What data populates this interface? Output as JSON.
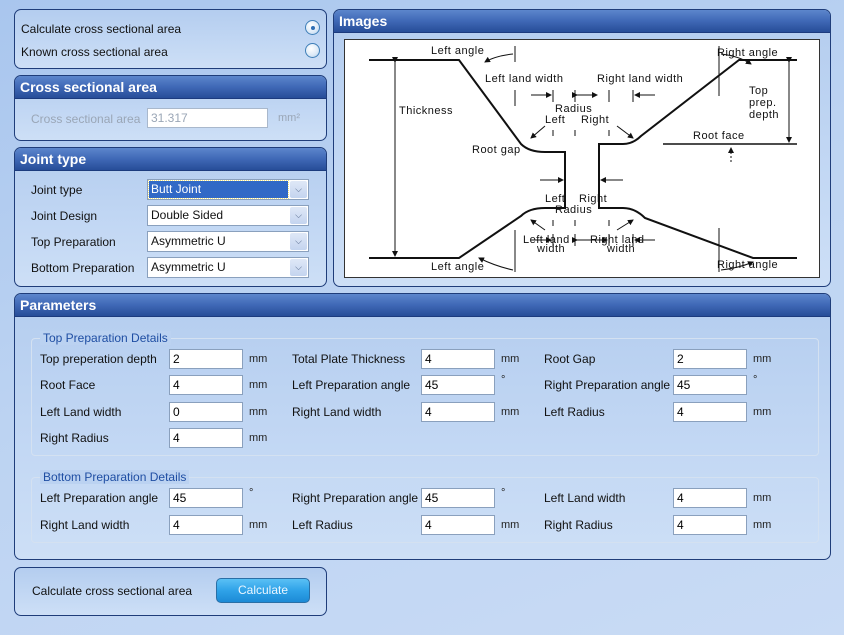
{
  "mode": {
    "options": [
      {
        "label": "Calculate cross sectional area",
        "selected": true
      },
      {
        "label": "Known cross sectional area",
        "selected": false
      }
    ]
  },
  "cross_section": {
    "title": "Cross sectional area",
    "field_label": "Cross sectional area",
    "value": "31.317",
    "unit": "mm²"
  },
  "joint_type": {
    "title": "Joint type",
    "fields": [
      {
        "label": "Joint type",
        "value": "Butt Joint"
      },
      {
        "label": "Joint Design",
        "value": "Double Sided"
      },
      {
        "label": "Top Preparation",
        "value": "Asymmetric U"
      },
      {
        "label": "Bottom Preparation",
        "value": "Asymmetric U"
      }
    ],
    "dropdown_icon": "chevron-down-icon"
  },
  "images": {
    "title": "Images",
    "diagram_labels": {
      "left_angle_top": "Left angle",
      "right_angle_top": "Right angle",
      "left_land_width_top": "Left land width",
      "right_land_width_top": "Right land width",
      "thickness": "Thickness",
      "radius_top": "Radius",
      "left_top": "Left",
      "right_top": "Right",
      "top_prep_1": "Top",
      "top_prep_2": "prep.",
      "top_prep_3": "depth",
      "root_face": "Root face",
      "root_gap": "Root gap",
      "left_bottom": "Left",
      "right_bottom": "Right",
      "radius_bottom": "Radius",
      "left_land_bottom_1": "Left land",
      "left_land_bottom_2": "width",
      "right_land_bottom_1": "Right land",
      "right_land_bottom_2": "width",
      "left_angle_bottom": "Left angle",
      "right_angle_bottom": "Right angle"
    }
  },
  "parameters": {
    "title": "Parameters",
    "top": {
      "title": "Top Preparation Details",
      "fields": [
        {
          "label": "Top preperation depth",
          "value": "2",
          "unit": "mm"
        },
        {
          "label": "Total Plate Thickness",
          "value": "4",
          "unit": "mm"
        },
        {
          "label": "Root Gap",
          "value": "2",
          "unit": "mm"
        },
        {
          "label": "Root Face",
          "value": "4",
          "unit": "mm"
        },
        {
          "label": "Left Preparation angle",
          "value": "45",
          "unit": "°"
        },
        {
          "label": "Right Preparation angle",
          "value": "45",
          "unit": "°"
        },
        {
          "label": "Left Land width",
          "value": "0",
          "unit": "mm"
        },
        {
          "label": "Right Land width",
          "value": "4",
          "unit": "mm"
        },
        {
          "label": "Left Radius",
          "value": "4",
          "unit": "mm"
        },
        {
          "label": "Right Radius",
          "value": "4",
          "unit": "mm"
        }
      ]
    },
    "bottom": {
      "title": "Bottom Preparation Details",
      "fields": [
        {
          "label": "Left Preparation angle",
          "value": "45",
          "unit": "°"
        },
        {
          "label": "Right Preparation angle",
          "value": "45",
          "unit": "°"
        },
        {
          "label": "Left Land width",
          "value": "4",
          "unit": "mm"
        },
        {
          "label": "Right Land width",
          "value": "4",
          "unit": "mm"
        },
        {
          "label": "Left Radius",
          "value": "4",
          "unit": "mm"
        },
        {
          "label": "Right Radius",
          "value": "4",
          "unit": "mm"
        }
      ]
    }
  },
  "calculate": {
    "label": "Calculate cross sectional area",
    "button": "Calculate"
  }
}
